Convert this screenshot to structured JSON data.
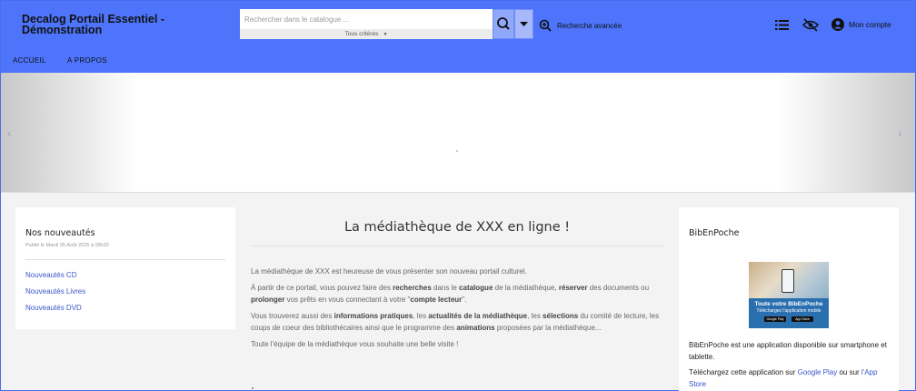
{
  "header": {
    "site_title": "Decalog Portail Essentiel - Démonstration",
    "search_placeholder": "Rechercher dans le catalogue ...",
    "criteria_label": "Tous critères",
    "advanced_search_label": "Recherche avancée",
    "account_label": "Mon compte",
    "bg_color": "#4d74fa"
  },
  "nav": {
    "items": [
      "ACCUEIL",
      "A PROPOS"
    ]
  },
  "left_panel": {
    "title": "Nos nouveautés",
    "published": "Publié le Mardi 05 Août 2025 à 09h20",
    "links": [
      "Nouveautés CD",
      "Nouveautés Livres",
      "Nouveautés DVD"
    ]
  },
  "main": {
    "title": "La médiathèque de XXX en ligne !",
    "p1": "La médiathèque de XXX est heureuse de vous présenter son nouveau portail culturel.",
    "p2_parts": [
      "À partir de ce portail, vous pouvez faire des ",
      "recherches",
      " dans le ",
      "catalogue",
      " de la médiathèque, ",
      "réserver",
      " des documents ou ",
      "prolonger",
      " vos prêts en vous connectant à votre \"",
      "compte lecteur",
      "\"."
    ],
    "p3_parts": [
      "Vous trouverez aussi des ",
      "informations pratiques",
      ", les ",
      "actualités de la médiathèque",
      ", les ",
      "sélections",
      " du comité de lecture, les coups de coeur des bibliothécaires ainsi que le programme des ",
      "animations",
      " proposées par la médiathèque..."
    ],
    "p4": "Toute l'équipe de la médiathèque vous souhaite une belle visite !"
  },
  "right_panel": {
    "title": "BibEnPoche",
    "image_title": "Toute votre BibEnPoche",
    "image_subtitle": "Téléchargez l'application mobile",
    "badge_google": "Google Play",
    "badge_apple": "App Store",
    "text1": "BibEnPoche est une application disponible sur smartphone et tablette.",
    "text2_prefix": "Téléchargez cette application sur ",
    "text2_link1": "Google Play",
    "text2_mid": " ou sur ",
    "text2_link2": "l'App Store"
  }
}
